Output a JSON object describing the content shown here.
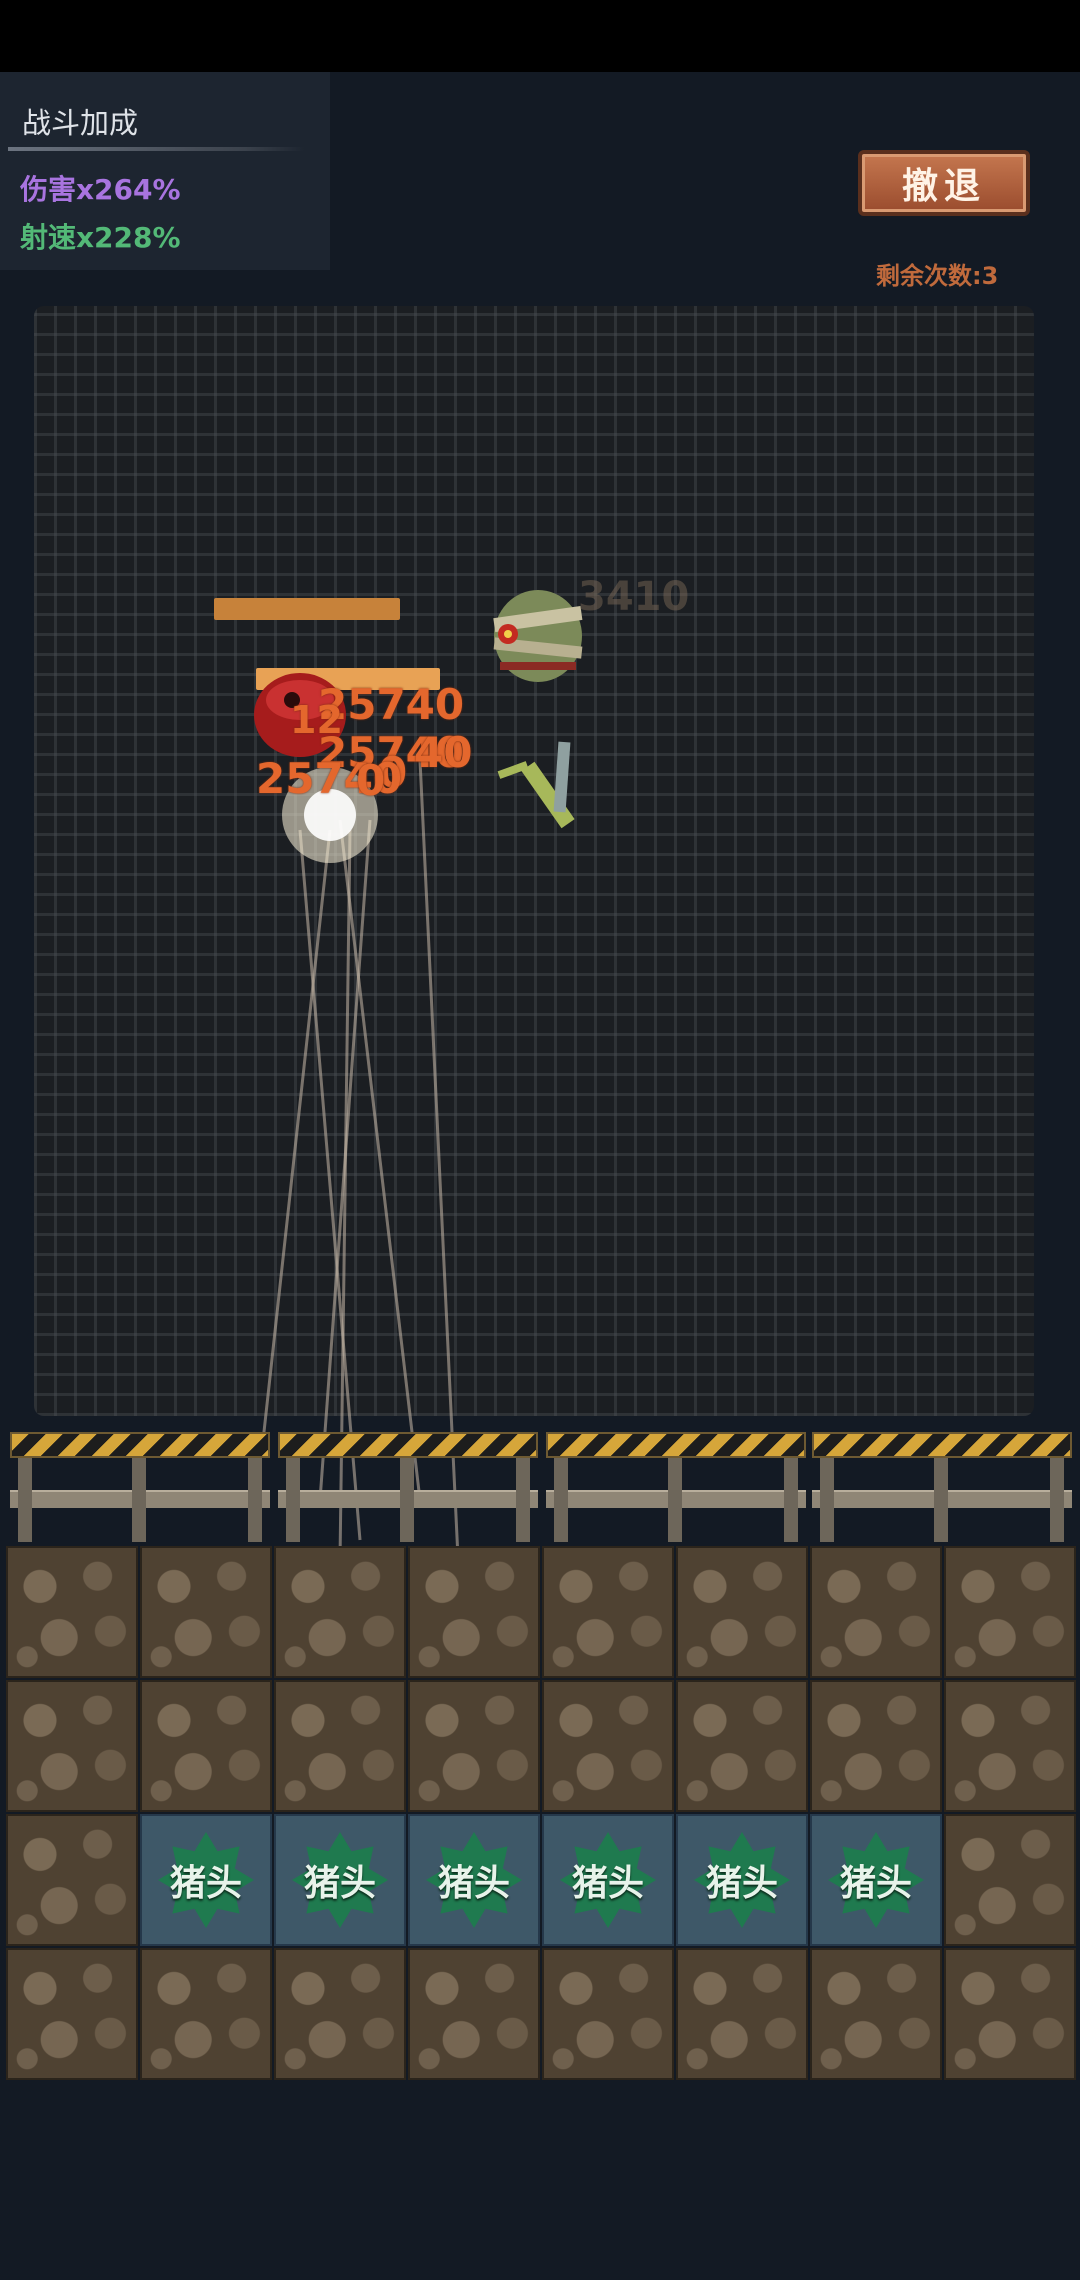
{
  "buff_panel": {
    "title": "战斗加成",
    "damage": "伤害x264%",
    "fire_rate": "射速x228%"
  },
  "retreat": {
    "label": "撤退",
    "remaining": "剩余次数:3"
  },
  "damage_numbers": [
    "25740",
    "12",
    "25740",
    "40",
    "0",
    "25740",
    "0"
  ],
  "faded_damage": "3410",
  "slots": [
    "猪头",
    "猪头",
    "猪头",
    "猪头",
    "猪头",
    "猪头"
  ],
  "colors": {
    "accent": "#c06a3c",
    "damage_text": "#e4672d",
    "hp_bar": "#e8a255"
  }
}
